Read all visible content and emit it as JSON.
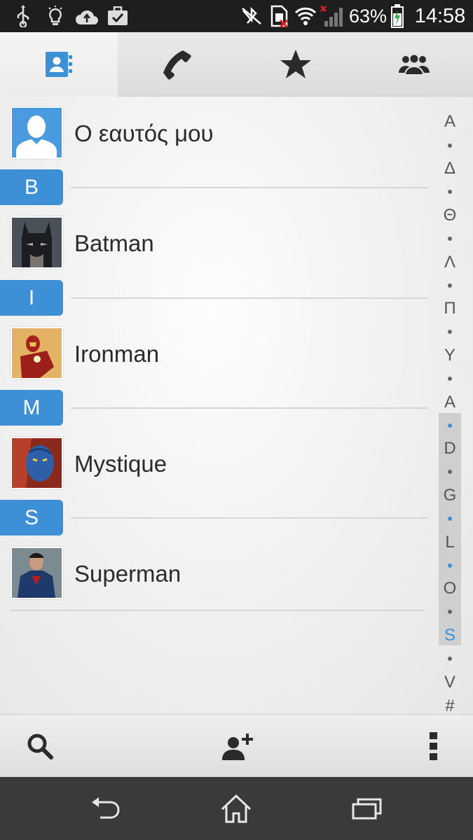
{
  "status_bar": {
    "battery_percent": "63%",
    "time": "14:58",
    "left_icons": [
      "usb-icon",
      "lightbulb-icon",
      "cloud-upload-icon",
      "briefcase-check-icon"
    ],
    "right_icons": [
      "nfc-off-icon",
      "sim-error-icon",
      "wifi-icon",
      "signal-icon",
      "battery-charging-icon"
    ]
  },
  "tabs": [
    {
      "name": "contacts",
      "icon": "contacts-book-icon",
      "active": true
    },
    {
      "name": "phone",
      "icon": "phone-icon",
      "active": false
    },
    {
      "name": "favorites",
      "icon": "star-icon",
      "active": false
    },
    {
      "name": "groups",
      "icon": "group-icon",
      "active": false
    }
  ],
  "me": {
    "name": "Ο εαυτός μου"
  },
  "sections": [
    {
      "letter": "B",
      "contact": "Batman"
    },
    {
      "letter": "I",
      "contact": "Ironman"
    },
    {
      "letter": "M",
      "contact": "Mystique"
    },
    {
      "letter": "S",
      "contact": "Superman"
    }
  ],
  "index": {
    "letters": [
      "A",
      "Δ",
      "Θ",
      "Λ",
      "Π",
      "Υ",
      "A",
      "D",
      "G",
      "L",
      "O",
      "S",
      "V",
      "#"
    ],
    "active": "S"
  },
  "actions": {
    "search": "search-icon",
    "add": "add-contact-icon",
    "menu": "overflow-menu-icon"
  },
  "nav": {
    "back": "back-icon",
    "home": "home-icon",
    "recent": "recent-apps-icon"
  },
  "colors": {
    "accent": "#3d8fd6",
    "status_bar": "#1e1e1e",
    "nav_bar": "#3a3a3a",
    "text": "#2b2b2b"
  }
}
